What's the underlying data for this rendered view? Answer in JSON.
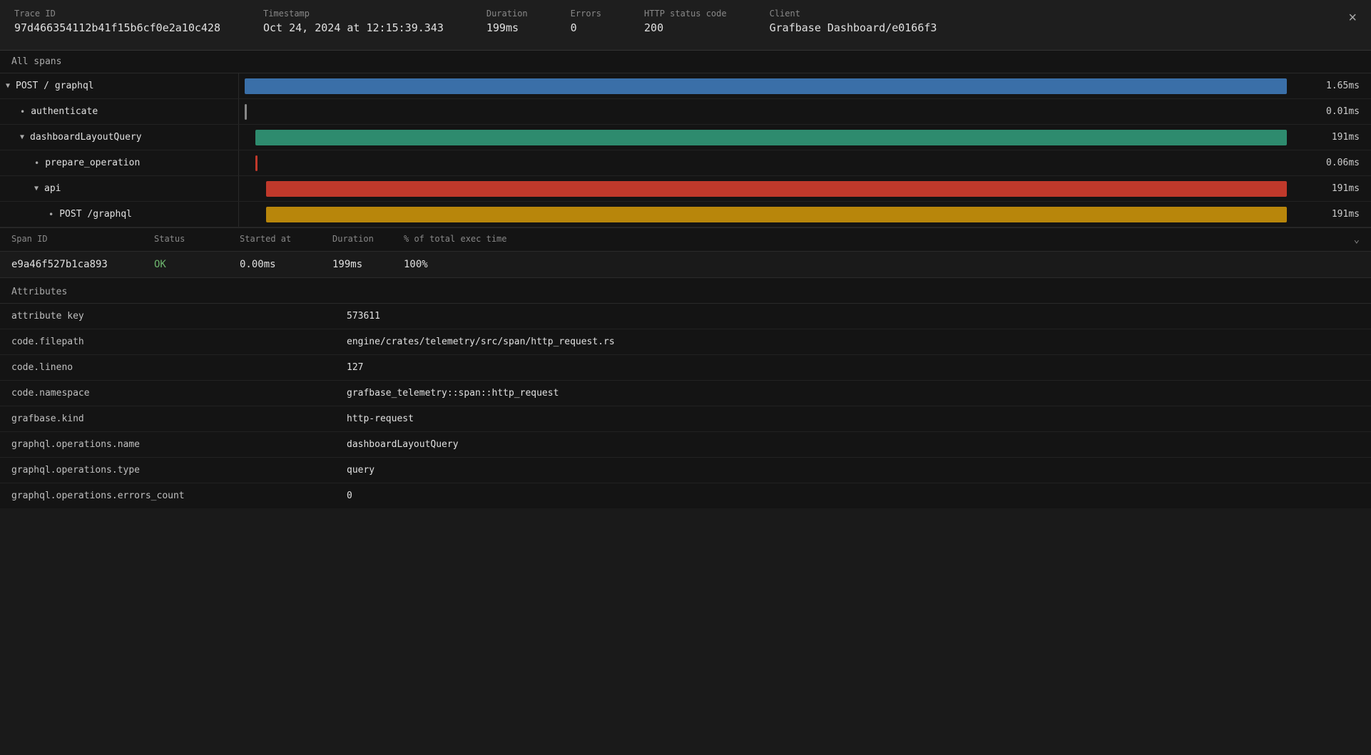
{
  "header": {
    "trace_id_label": "Trace ID",
    "trace_id_value": "97d466354112b41f15b6cf0e2a10c428",
    "timestamp_label": "Timestamp",
    "timestamp_value": "Oct 24, 2024 at 12:15:39.343",
    "duration_label": "Duration",
    "duration_value": "199ms",
    "errors_label": "Errors",
    "errors_value": "0",
    "http_status_label": "HTTP status code",
    "http_status_value": "200",
    "client_label": "Client",
    "client_value": "Grafbase Dashboard/e0166f3",
    "close_label": "×"
  },
  "spans_panel": {
    "header_label": "All spans",
    "spans": [
      {
        "id": "span-1",
        "name": "POST / graphql",
        "indent": 0,
        "has_toggle": true,
        "expanded": true,
        "has_dot": false,
        "bar_color": "#3a6fa8",
        "bar_width_pct": 98,
        "bar_left_pct": 0,
        "duration": "1.65ms"
      },
      {
        "id": "span-2",
        "name": "authenticate",
        "indent": 1,
        "has_toggle": false,
        "expanded": false,
        "has_dot": true,
        "bar_color": "#888",
        "bar_width_pct": 0.5,
        "bar_left_pct": 0,
        "duration": "0.01ms"
      },
      {
        "id": "span-3",
        "name": "dashboardLayoutQuery",
        "indent": 1,
        "has_toggle": true,
        "expanded": true,
        "has_dot": false,
        "bar_color": "#2e8b6e",
        "bar_width_pct": 97,
        "bar_left_pct": 1,
        "duration": "191ms"
      },
      {
        "id": "span-4",
        "name": "prepare_operation",
        "indent": 2,
        "has_toggle": false,
        "expanded": false,
        "has_dot": true,
        "bar_color": "#c0392b",
        "bar_width_pct": 0.5,
        "bar_left_pct": 1,
        "duration": "0.06ms"
      },
      {
        "id": "span-5",
        "name": "api",
        "indent": 2,
        "has_toggle": true,
        "expanded": true,
        "has_dot": false,
        "bar_color": "#c0392b",
        "bar_width_pct": 96,
        "bar_left_pct": 2,
        "duration": "191ms"
      },
      {
        "id": "span-6",
        "name": "POST /graphql",
        "indent": 3,
        "has_toggle": false,
        "expanded": false,
        "has_dot": true,
        "bar_color": "#b8860b",
        "bar_width_pct": 96,
        "bar_left_pct": 2,
        "duration": "191ms"
      }
    ]
  },
  "details": {
    "span_id_label": "Span ID",
    "status_label": "Status",
    "started_at_label": "Started at",
    "duration_label": "Duration",
    "exec_time_label": "% of total exec time",
    "span_id_value": "e9a46f527b1ca893",
    "status_value": "OK",
    "started_at_value": "0.00ms",
    "duration_value": "199ms",
    "exec_time_value": "100%"
  },
  "attributes": {
    "title": "Attributes",
    "rows": [
      {
        "key": "attribute key",
        "value": "573611"
      },
      {
        "key": "code.filepath",
        "value": "engine/crates/telemetry/src/span/http_request.rs"
      },
      {
        "key": "code.lineno",
        "value": "127"
      },
      {
        "key": "code.namespace",
        "value": "grafbase_telemetry::span::http_request"
      },
      {
        "key": "grafbase.kind",
        "value": "http-request"
      },
      {
        "key": "graphql.operations.name",
        "value": "dashboardLayoutQuery"
      },
      {
        "key": "graphql.operations.type",
        "value": "query"
      },
      {
        "key": "graphql.operations.errors_count",
        "value": "0"
      }
    ]
  }
}
